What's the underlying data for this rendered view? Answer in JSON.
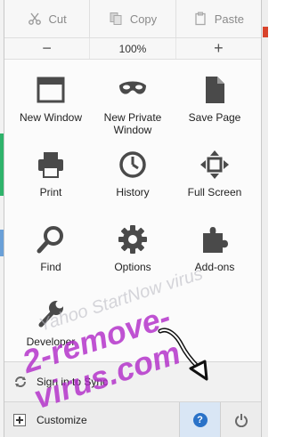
{
  "edit": {
    "cut_label": "Cut",
    "copy_label": "Copy",
    "paste_label": "Paste"
  },
  "zoom": {
    "minus": "−",
    "level": "100%",
    "plus": "+"
  },
  "tiles": [
    {
      "label": "New Window",
      "icon": "window-icon"
    },
    {
      "label": "New Private Window",
      "icon": "private-mask-icon"
    },
    {
      "label": "Save Page",
      "icon": "page-icon"
    },
    {
      "label": "Print",
      "icon": "printer-icon"
    },
    {
      "label": "History",
      "icon": "clock-icon"
    },
    {
      "label": "Full Screen",
      "icon": "fullscreen-icon"
    },
    {
      "label": "Find",
      "icon": "magnifier-icon"
    },
    {
      "label": "Options",
      "icon": "gear-icon"
    },
    {
      "label": "Add-ons",
      "icon": "puzzle-icon"
    },
    {
      "label": "Developer",
      "icon": "wrench-icon"
    }
  ],
  "sync": {
    "label": "Sign in to Sync"
  },
  "customize": {
    "label": "Customize"
  },
  "help": {
    "glyph": "?"
  },
  "watermark": {
    "main": "2-remove-virus.com",
    "faint": "Yahoo StartNow virus"
  },
  "colors": {
    "help_blue": "#2a72c8",
    "icon_gray": "#4a4a4a",
    "watermark_purple": "#b028c8"
  }
}
